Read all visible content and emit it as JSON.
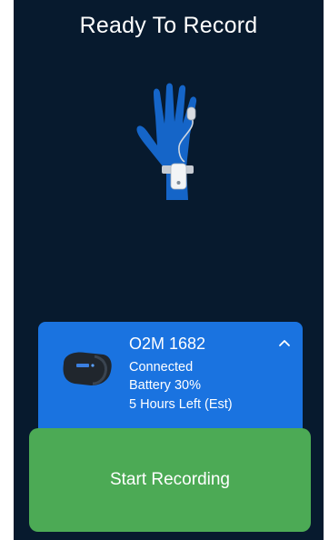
{
  "header": {
    "title": "Ready To Record"
  },
  "illustration": {
    "icon": "hand-with-oximeter-icon"
  },
  "device_card": {
    "name": "O2M 1682",
    "status": "Connected",
    "battery": "Battery 30%",
    "time_left": "5 Hours Left (Est)",
    "expand_icon": "chevron-up-icon",
    "device_icon": "ring-oximeter-icon"
  },
  "actions": {
    "start_label": "Start Recording"
  },
  "colors": {
    "background": "#071a2e",
    "card": "#1a73e0",
    "start_button": "#4caa55",
    "hand": "#1565c8"
  }
}
